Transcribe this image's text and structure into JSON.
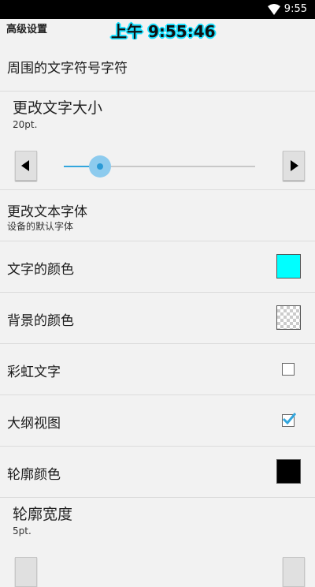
{
  "statusbar": {
    "time": "9:55",
    "icon": "wifi-icon"
  },
  "titlebar": {
    "title": "高级设置",
    "clock_overlay": "上午 9:55:46"
  },
  "settings": {
    "surrounding_chars": {
      "label": "周围的文字符号字符"
    },
    "text_size": {
      "label": "更改文字大小",
      "value": "20pt.",
      "slider_fraction": 0.19
    },
    "font": {
      "label": "更改文本字体",
      "sub": "设备的默认字体"
    },
    "text_color": {
      "label": "文字的颜色",
      "color": "#00ffff"
    },
    "bg_color": {
      "label": "背景的颜色",
      "color": "transparent"
    },
    "rainbow": {
      "label": "彩虹文字",
      "checked": false
    },
    "outline_view": {
      "label": "大纲视图",
      "checked": true
    },
    "outline_color": {
      "label": "轮廓颜色",
      "color": "#000000"
    },
    "outline_width": {
      "label": "轮廓宽度",
      "value": "5pt."
    }
  },
  "colors": {
    "accent": "#33a6dd",
    "background": "#f2f2f2"
  }
}
